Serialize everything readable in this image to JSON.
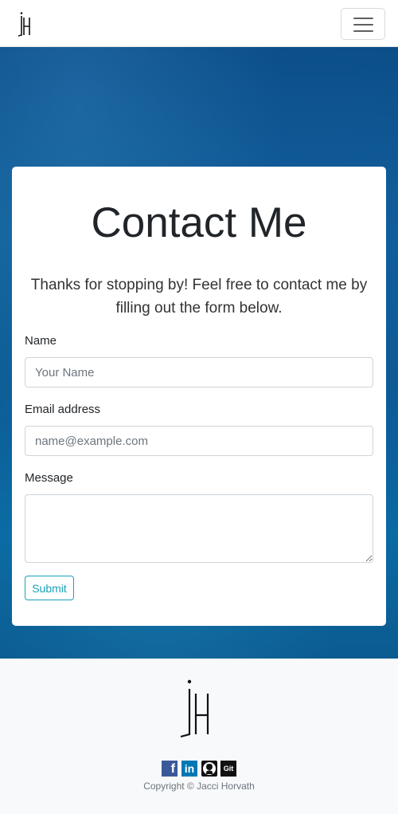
{
  "navbar": {
    "brand_icon": "jh-logo",
    "toggler_icon": "hamburger-menu-icon"
  },
  "contact": {
    "title": "Contact Me",
    "lead": "Thanks for stopping by! Feel free to contact me by filling out the form below.",
    "name_label": "Name",
    "name_placeholder": "Your Name",
    "email_label": "Email address",
    "email_placeholder": "name@example.com",
    "message_label": "Message",
    "submit_label": "Submit"
  },
  "footer": {
    "logo_icon": "jh-logo",
    "social_icons": [
      "facebook-icon",
      "linkedin-icon",
      "github-icon",
      "git-icon"
    ],
    "git_text": "Git",
    "copyright": "Copyright © Jacci Horvath"
  },
  "colors": {
    "accent": "#17a2b8",
    "hero_blue": "#0b5a94",
    "facebook": "#3b5998",
    "linkedin": "#0077b5"
  }
}
